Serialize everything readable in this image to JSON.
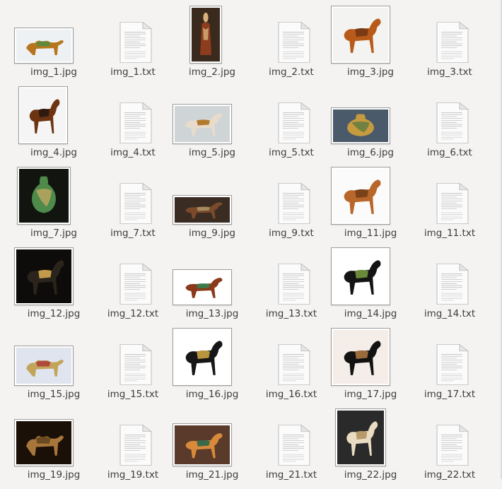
{
  "window": {
    "background": "#f4f3f1"
  },
  "files": [
    {
      "name": "img_1.jpg",
      "kind": "image",
      "icon": "camel-thumbnail-icon"
    },
    {
      "name": "img_1.txt",
      "kind": "text",
      "icon": "text-document-icon"
    },
    {
      "name": "img_2.jpg",
      "kind": "image",
      "icon": "figure-thumbnail-icon"
    },
    {
      "name": "img_2.txt",
      "kind": "text",
      "icon": "text-document-icon"
    },
    {
      "name": "img_3.jpg",
      "kind": "image",
      "icon": "horse-thumbnail-icon"
    },
    {
      "name": "img_3.txt",
      "kind": "text",
      "icon": "text-document-icon"
    },
    {
      "name": "img_4.jpg",
      "kind": "image",
      "icon": "horse-thumbnail-icon"
    },
    {
      "name": "img_4.txt",
      "kind": "text",
      "icon": "text-document-icon"
    },
    {
      "name": "img_5.jpg",
      "kind": "image",
      "icon": "horse-thumbnail-icon"
    },
    {
      "name": "img_5.txt",
      "kind": "text",
      "icon": "text-document-icon"
    },
    {
      "name": "img_6.jpg",
      "kind": "image",
      "icon": "vase-thumbnail-icon"
    },
    {
      "name": "img_6.txt",
      "kind": "text",
      "icon": "text-document-icon"
    },
    {
      "name": "img_7.jpg",
      "kind": "image",
      "icon": "vase-thumbnail-icon"
    },
    {
      "name": "img_7.txt",
      "kind": "text",
      "icon": "text-document-icon"
    },
    {
      "name": "img_9.jpg",
      "kind": "image",
      "icon": "horse-thumbnail-icon"
    },
    {
      "name": "img_9.txt",
      "kind": "text",
      "icon": "text-document-icon"
    },
    {
      "name": "img_11.jpg",
      "kind": "image",
      "icon": "horse-thumbnail-icon"
    },
    {
      "name": "img_11.txt",
      "kind": "text",
      "icon": "text-document-icon"
    },
    {
      "name": "img_12.jpg",
      "kind": "image",
      "icon": "horse-thumbnail-icon"
    },
    {
      "name": "img_12.txt",
      "kind": "text",
      "icon": "text-document-icon"
    },
    {
      "name": "img_13.jpg",
      "kind": "image",
      "icon": "horse-thumbnail-icon"
    },
    {
      "name": "img_13.txt",
      "kind": "text",
      "icon": "text-document-icon"
    },
    {
      "name": "img_14.jpg",
      "kind": "image",
      "icon": "horse-thumbnail-icon"
    },
    {
      "name": "img_14.txt",
      "kind": "text",
      "icon": "text-document-icon"
    },
    {
      "name": "img_15.jpg",
      "kind": "image",
      "icon": "camel-thumbnail-icon"
    },
    {
      "name": "img_15.txt",
      "kind": "text",
      "icon": "text-document-icon"
    },
    {
      "name": "img_16.jpg",
      "kind": "image",
      "icon": "horse-thumbnail-icon"
    },
    {
      "name": "img_16.txt",
      "kind": "text",
      "icon": "text-document-icon"
    },
    {
      "name": "img_17.jpg",
      "kind": "image",
      "icon": "horse-thumbnail-icon"
    },
    {
      "name": "img_17.txt",
      "kind": "text",
      "icon": "text-document-icon"
    },
    {
      "name": "img_19.jpg",
      "kind": "image",
      "icon": "camel-thumbnail-icon"
    },
    {
      "name": "img_19.txt",
      "kind": "text",
      "icon": "text-document-icon"
    },
    {
      "name": "img_21.jpg",
      "kind": "image",
      "icon": "horse-thumbnail-icon"
    },
    {
      "name": "img_21.txt",
      "kind": "text",
      "icon": "text-document-icon"
    },
    {
      "name": "img_22.jpg",
      "kind": "image",
      "icon": "horse-thumbnail-icon"
    },
    {
      "name": "img_22.txt",
      "kind": "text",
      "icon": "text-document-icon"
    }
  ]
}
